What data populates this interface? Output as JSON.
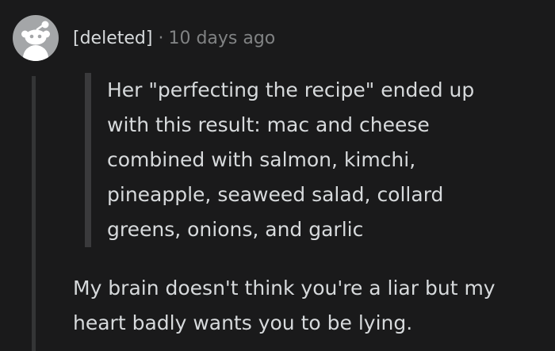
{
  "comment": {
    "avatar_icon": "snoo-avatar-icon",
    "author": "[deleted]",
    "separator": "·",
    "timestamp": "10 days ago",
    "quote": "Her \"perfecting the recipe\" ended up\nwith this result: mac and cheese\ncombined with salmon, kimchi,\npineapple, seaweed salad, collard\ngreens, onions, and garlic",
    "body": "My brain doesn't think you're a liar but my\nheart badly wants you to be lying."
  },
  "colors": {
    "background": "#1a1a1b",
    "text": "#d7dadc",
    "muted": "#818384",
    "avatar_bg": "#a4a6a8",
    "quote_bar": "#3a3a3c",
    "thread_line": "#343536"
  }
}
